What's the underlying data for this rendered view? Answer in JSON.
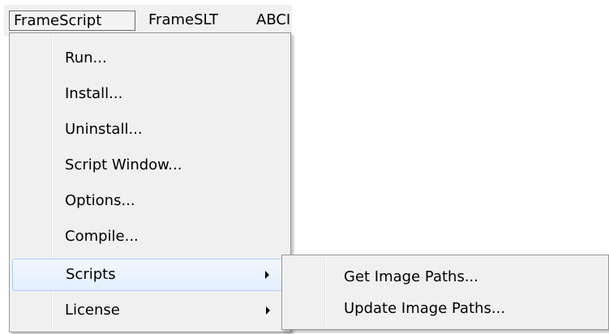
{
  "menubar": {
    "items": [
      {
        "label": "FrameScript"
      },
      {
        "label": "FrameSLT"
      },
      {
        "label": "ABCI"
      }
    ]
  },
  "main_menu": {
    "items": [
      {
        "label": "Run..."
      },
      {
        "label": "Install..."
      },
      {
        "label": "Uninstall..."
      },
      {
        "label": "Script Window..."
      },
      {
        "label": "Options..."
      },
      {
        "label": "Compile..."
      },
      {
        "label": "Scripts"
      },
      {
        "label": "License"
      }
    ]
  },
  "scripts_submenu": {
    "items": [
      {
        "label": "Get Image Paths..."
      },
      {
        "label": "Update Image Paths..."
      }
    ]
  },
  "icons": {
    "submenu_arrow": "chevron-right-icon"
  },
  "colors": {
    "menu_background": "#f0f0f0",
    "highlight_border": "#aecff7",
    "highlight_fill": "#e3effd"
  }
}
